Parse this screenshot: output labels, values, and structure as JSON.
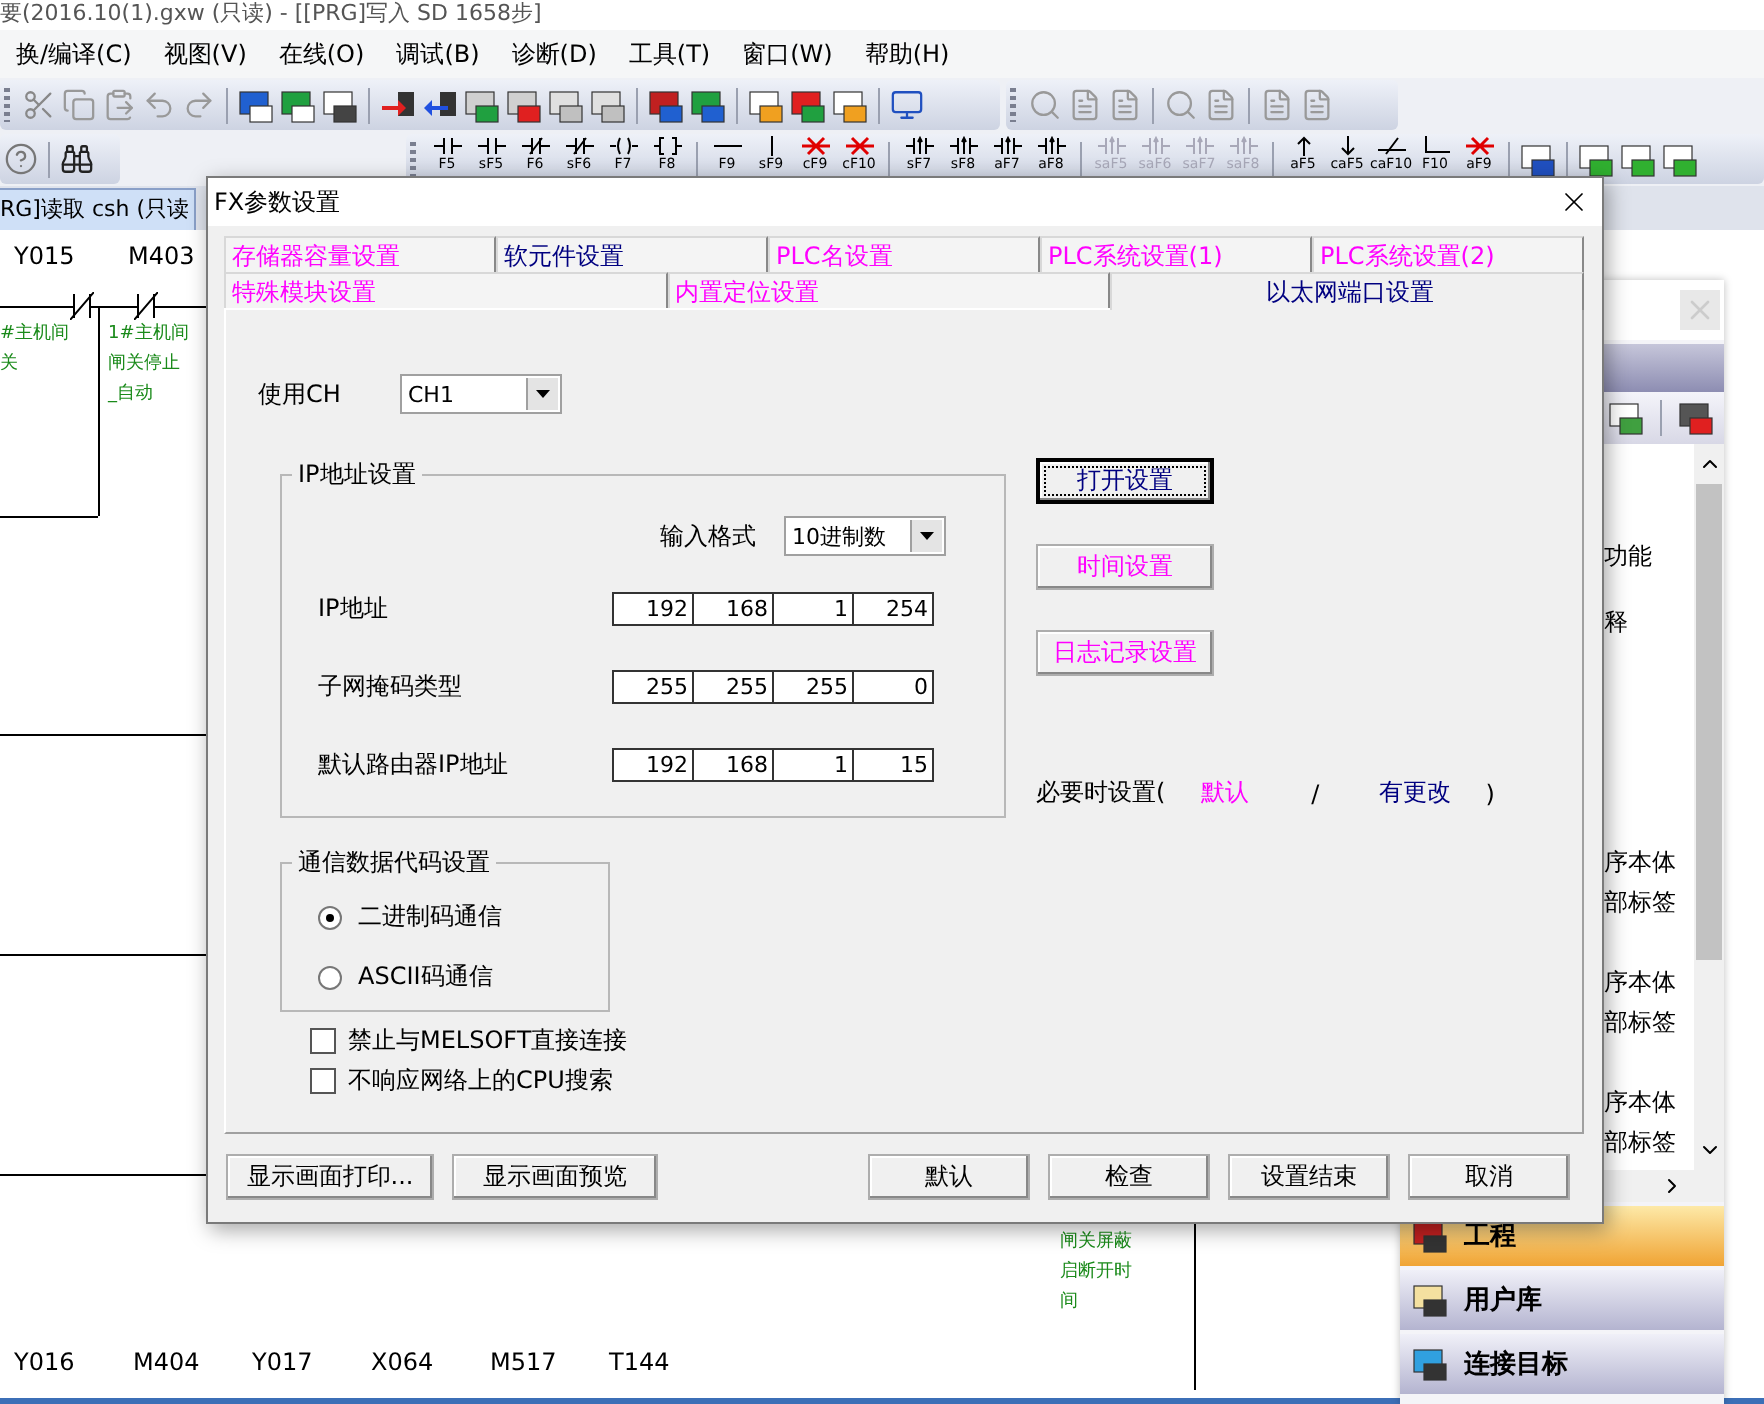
{
  "window": {
    "title": "要(2016.10(1).gxw (只读) - [[PRG]写入 SD 1658步]"
  },
  "menu": [
    "换/编译(C)",
    "视图(V)",
    "在线(O)",
    "调试(B)",
    "诊断(D)",
    "工具(T)",
    "窗口(W)",
    "帮助(H)"
  ],
  "ladder_toolbar": [
    {
      "label": "F5",
      "kind": "contact",
      "disabled": false
    },
    {
      "label": "sF5",
      "kind": "contact",
      "disabled": false
    },
    {
      "label": "F6",
      "kind": "contact_nc",
      "disabled": false
    },
    {
      "label": "sF6",
      "kind": "contact_nc",
      "disabled": false
    },
    {
      "label": "F7",
      "kind": "coil",
      "disabled": false
    },
    {
      "label": "F8",
      "kind": "bracket",
      "disabled": false
    },
    {
      "label": "F9",
      "kind": "hline",
      "disabled": false
    },
    {
      "label": "sF9",
      "kind": "vline",
      "disabled": false
    },
    {
      "label": "cF9",
      "kind": "delete",
      "disabled": false
    },
    {
      "label": "cF10",
      "kind": "delete",
      "disabled": false
    },
    {
      "label": "sF7",
      "kind": "pulse",
      "disabled": false
    },
    {
      "label": "sF8",
      "kind": "pulse",
      "disabled": false
    },
    {
      "label": "aF7",
      "kind": "pulse",
      "disabled": false
    },
    {
      "label": "aF8",
      "kind": "pulse",
      "disabled": false
    },
    {
      "label": "saF5",
      "kind": "pulse",
      "disabled": true
    },
    {
      "label": "saF6",
      "kind": "pulse",
      "disabled": true
    },
    {
      "label": "saF7",
      "kind": "pulse",
      "disabled": true
    },
    {
      "label": "saF8",
      "kind": "pulse",
      "disabled": true
    },
    {
      "label": "aF5",
      "kind": "arrow_up",
      "disabled": false
    },
    {
      "label": "caF5",
      "kind": "arrow_down",
      "disabled": false
    },
    {
      "label": "caF10",
      "kind": "invert",
      "disabled": false
    },
    {
      "label": "F10",
      "kind": "corner",
      "disabled": false
    },
    {
      "label": "aF9",
      "kind": "delete",
      "disabled": false
    }
  ],
  "editor": {
    "tab": "RG]读取 csh (只读",
    "top_devices": [
      "Y015",
      "M403"
    ],
    "comments": [
      [
        "#主机间",
        "关"
      ],
      [
        "1#主机间",
        "闸关停止",
        "_自动"
      ],
      [
        "闸关屏蔽",
        "启断开时",
        "间"
      ]
    ],
    "bottom_devices": [
      "Y016",
      "M404",
      "Y017",
      "X064",
      "M517",
      "T144"
    ]
  },
  "navigator": {
    "items": [
      "功能",
      "释",
      "序本体",
      "部标签",
      "序本体",
      "部标签",
      "序本体",
      "部标签"
    ],
    "sections": [
      {
        "label": "工程",
        "selected": true
      },
      {
        "label": "用户库",
        "selected": false
      },
      {
        "label": "连接目标",
        "selected": false
      }
    ]
  },
  "dialog": {
    "title": "FX参数设置",
    "tab_rows": [
      [
        {
          "label": "存储器容量设置",
          "modified": true,
          "selected": false
        },
        {
          "label": "软元件设置",
          "modified": false,
          "selected": false
        },
        {
          "label": "PLC名设置",
          "modified": true,
          "selected": false
        },
        {
          "label": "PLC系统设置(1)",
          "modified": true,
          "selected": false
        },
        {
          "label": "PLC系统设置(2)",
          "modified": true,
          "selected": false
        }
      ],
      [
        {
          "label": "特殊模块设置",
          "modified": true,
          "selected": false
        },
        {
          "label": "内置定位设置",
          "modified": true,
          "selected": false
        },
        {
          "label": "以太网端口设置",
          "modified": false,
          "selected": true
        }
      ]
    ],
    "channel": {
      "label": "使用CH",
      "value": "CH1"
    },
    "ip_group": {
      "title": "IP地址设置",
      "format_label": "输入格式",
      "format_value": "10进制数",
      "rows": [
        {
          "label": "IP地址",
          "octets": [
            "192",
            "168",
            "1",
            "254"
          ]
        },
        {
          "label": "子网掩码类型",
          "octets": [
            "255",
            "255",
            "255",
            "0"
          ]
        },
        {
          "label": "默认路由器IP地址",
          "octets": [
            "192",
            "168",
            "1",
            "15"
          ]
        }
      ]
    },
    "side_buttons": [
      {
        "label": "打开设置",
        "modified": false,
        "focused": true
      },
      {
        "label": "时间设置",
        "modified": true,
        "focused": false
      },
      {
        "label": "日志记录设置",
        "modified": true,
        "focused": false
      }
    ],
    "legend": {
      "prefix": "必要时设置(",
      "default_label": "默认",
      "separator": "/",
      "changed_label": "有更改",
      "suffix": ")"
    },
    "code_group": {
      "title": "通信数据代码设置",
      "options": [
        {
          "label": "二进制码通信",
          "selected": true
        },
        {
          "label": "ASCII码通信",
          "selected": false
        }
      ]
    },
    "checkboxes": [
      {
        "label": "禁止与MELSOFT直接连接",
        "checked": false
      },
      {
        "label": "不响应网络上的CPU搜索",
        "checked": false
      }
    ],
    "footer_left": [
      "显示画面打印...",
      "显示画面预览"
    ],
    "footer_right": [
      "默认",
      "检查",
      "设置结束",
      "取消"
    ]
  }
}
